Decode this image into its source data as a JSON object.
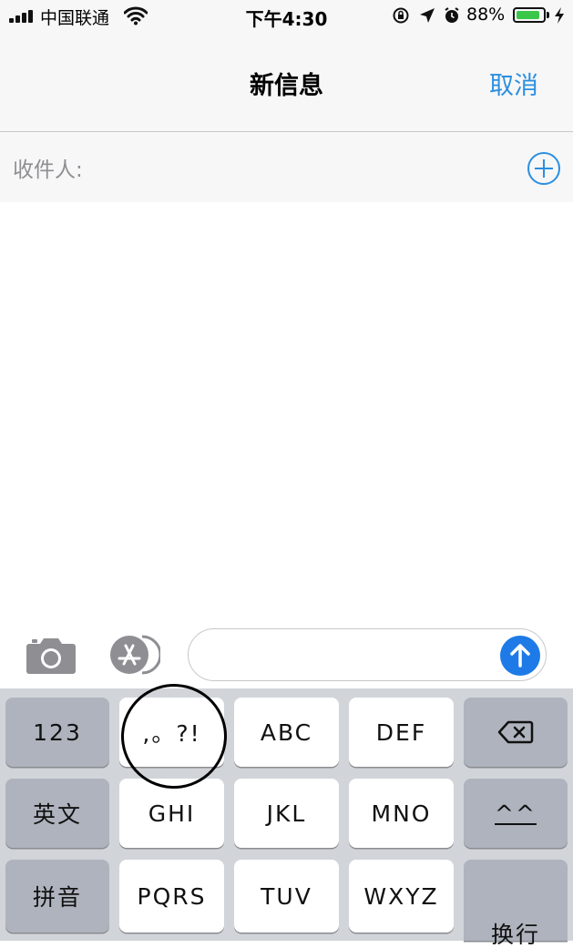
{
  "status_bar": {
    "carrier": "中国联通",
    "time": "下午4:30",
    "battery_percent": "88%",
    "battery_level": 0.88
  },
  "nav": {
    "title": "新信息",
    "cancel_label": "取消",
    "accent_color": "#2b8fe0"
  },
  "recipient": {
    "label": "收件人:"
  },
  "compose": {
    "message_value": "",
    "send_color": "#1e7ae6"
  },
  "keyboard": {
    "rows": [
      [
        "123",
        ",。?!",
        "ABC",
        "DEF",
        "delete"
      ],
      [
        "英文",
        "GHI",
        "JKL",
        "MNO",
        "^^"
      ],
      [
        "拼音",
        "PQRS",
        "TUV",
        "WXYZ",
        "换行"
      ]
    ],
    "key_123": "123",
    "key_punct": ",。?!",
    "key_abc": "ABC",
    "key_def": "DEF",
    "key_english": "英文",
    "key_ghi": "GHI",
    "key_jkl": "JKL",
    "key_mno": "MNO",
    "key_emoticon": "^^",
    "key_pinyin": "拼音",
    "key_pqrs": "PQRS",
    "key_tuv": "TUV",
    "key_wxyz": "WXYZ",
    "key_return": "换行"
  }
}
